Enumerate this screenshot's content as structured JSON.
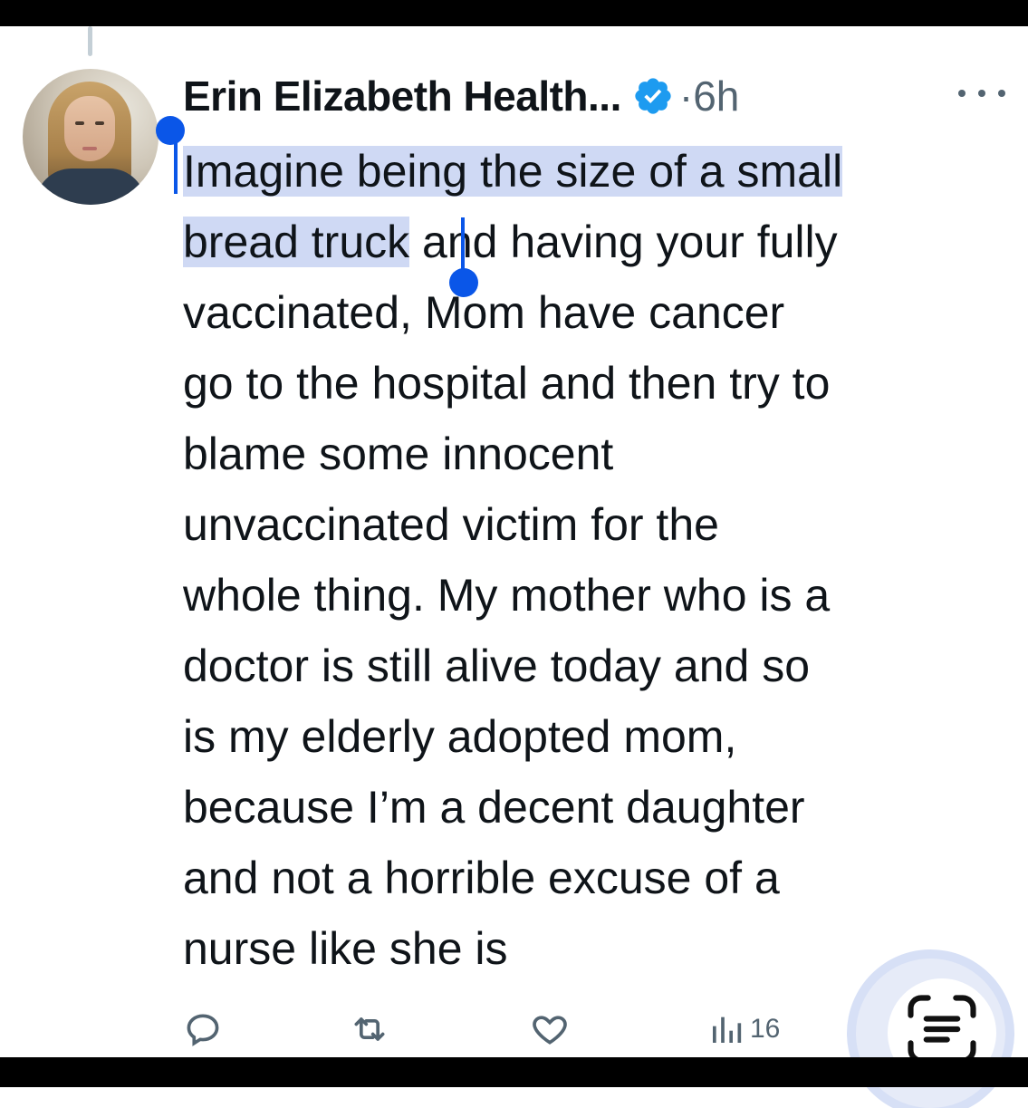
{
  "tweet": {
    "author": {
      "display_name": "Erin Elizabeth Health...",
      "verified_icon": "verified-badge-icon",
      "dot": "·",
      "time": "6h"
    },
    "text_lines": [
      "Imagine being the size of a small",
      "bread truck",
      " and having your fully",
      "vaccinated, Mom have cancer",
      "go to the hospital and then try to",
      "blame some innocent",
      "unvaccinated victim for the",
      "whole thing. My mother who is a",
      "doctor is still alive today and so",
      "is my elderly adopted mom,",
      "because I’m a decent daughter",
      "and not a horrible excuse of a",
      "nurse like she is"
    ],
    "actions": {
      "reply_icon": "reply-icon",
      "retweet_icon": "retweet-icon",
      "like_icon": "like-icon",
      "views_icon": "views-icon",
      "views_count": "16"
    }
  },
  "overlay": {
    "text_scan_icon": "text-scan-icon"
  },
  "colors": {
    "selection_highlight": "#cfd9f4",
    "selection_handle": "#0a56e8",
    "verified_blue": "#1d9bf0",
    "secondary_text": "#536471"
  }
}
